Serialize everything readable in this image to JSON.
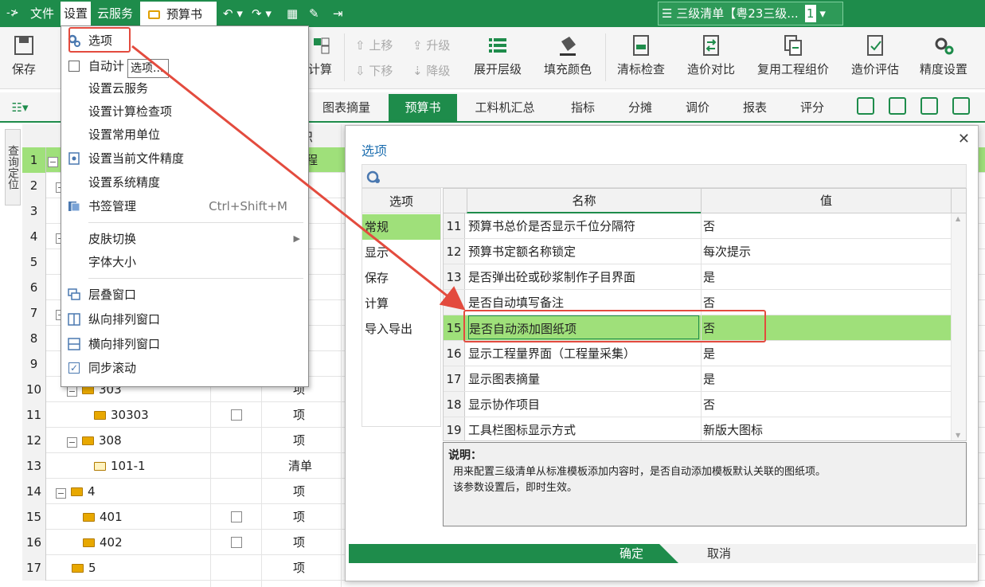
{
  "titlebar": {
    "logo": "-≯",
    "menus": [
      "文件",
      "设置",
      "云服务"
    ],
    "doc_tab": "预算书",
    "project_tab": "三级清单【粤23三级...",
    "project_num": "1"
  },
  "ribbon": {
    "save": "保存",
    "calc": "计算",
    "move_up": "上移",
    "move_down": "下移",
    "upgrade": "升级",
    "downgrade": "降级",
    "expand_level": "展开层级",
    "fill_color": "填充颜色",
    "qingbiao_check": "清标检查",
    "price_compare": "造价对比",
    "reuse_price": "复用工程组价",
    "price_eval": "造价评估",
    "precision": "精度设置"
  },
  "tabs": [
    "图表摘量",
    "预算书",
    "工料机汇总",
    "指标",
    "分摊",
    "调价",
    "报表",
    "评分"
  ],
  "active_tab": "预算书",
  "query_side": "查询定位",
  "grid": {
    "header_partial": "识",
    "row1_partial": "程",
    "rows": [
      {
        "n": "1"
      },
      {
        "n": "2"
      },
      {
        "n": "3"
      },
      {
        "n": "4"
      },
      {
        "n": "5"
      },
      {
        "n": "6"
      },
      {
        "n": "7"
      },
      {
        "n": "8"
      },
      {
        "n": "9"
      },
      {
        "n": "10",
        "code": "303",
        "type": "项"
      },
      {
        "n": "11",
        "code": "30303",
        "type": "项"
      },
      {
        "n": "12",
        "code": "308",
        "type": "项"
      },
      {
        "n": "13",
        "code": "101-1",
        "type": "清单"
      },
      {
        "n": "14",
        "code": "4",
        "type": "项"
      },
      {
        "n": "15",
        "code": "401",
        "type": "项"
      },
      {
        "n": "16",
        "code": "402",
        "type": "项"
      },
      {
        "n": "17",
        "code": "5",
        "type": "项"
      }
    ]
  },
  "menu": {
    "items": [
      {
        "label": "选项"
      },
      {
        "label": "自动计"
      },
      {
        "label": "设置云服务"
      },
      {
        "label": "设置计算检查项"
      },
      {
        "label": "设置常用单位"
      },
      {
        "label": "设置当前文件精度"
      },
      {
        "label": "设置系统精度"
      },
      {
        "label": "书签管理",
        "shortcut": "Ctrl+Shift+M"
      },
      {
        "label": "皮肤切换"
      },
      {
        "label": "字体大小"
      },
      {
        "label": "层叠窗口"
      },
      {
        "label": "纵向排列窗口"
      },
      {
        "label": "横向排列窗口"
      },
      {
        "label": "同步滚动"
      }
    ],
    "tooltip": "选项..."
  },
  "dialog": {
    "title": "选项",
    "close": "✕",
    "categories_header": "选项",
    "categories": [
      "常规",
      "显示",
      "保存",
      "计算",
      "导入导出"
    ],
    "selected_category": "常规",
    "col_name": "名称",
    "col_value": "值",
    "rows": [
      {
        "n": "11",
        "name": "预算书总价是否显示千位分隔符",
        "value": "否"
      },
      {
        "n": "12",
        "name": "预算书定额名称锁定",
        "value": "每次提示"
      },
      {
        "n": "13",
        "name": "是否弹出砼或砂浆制作子目界面",
        "value": "是"
      },
      {
        "n": "14",
        "name": "是否自动填写备注",
        "value": "否"
      },
      {
        "n": "15",
        "name": "是否自动添加图纸项",
        "value": "否"
      },
      {
        "n": "16",
        "name": "显示工程量界面（工程量采集）",
        "value": "是"
      },
      {
        "n": "17",
        "name": "显示图表摘量",
        "value": "是"
      },
      {
        "n": "18",
        "name": "显示协作项目",
        "value": "否"
      },
      {
        "n": "19",
        "name": "工具栏图标显示方式",
        "value": "新版大图标"
      }
    ],
    "desc_title": "说明：",
    "desc_line1": "用来配置三级清单从标准模板添加内容时，是否自动添加模板默认关联的图纸项。",
    "desc_line2": "该参数设置后，即时生效。",
    "ok": "确定",
    "cancel": "取消"
  },
  "colors": {
    "brand_green": "#1e8c4b",
    "selection_green": "#9fe07a",
    "annotation_red": "#e34b3e"
  }
}
